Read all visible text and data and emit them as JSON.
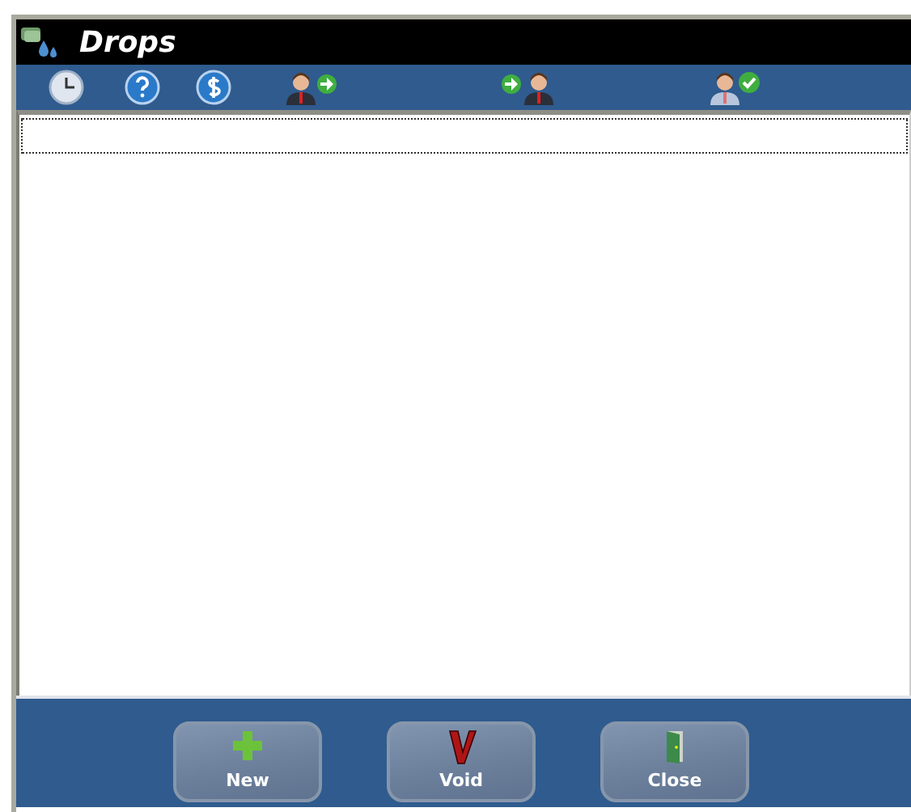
{
  "window": {
    "title": "Drops"
  },
  "columns": [
    {
      "kind": "clock"
    },
    {
      "kind": "help"
    },
    {
      "kind": "money"
    },
    {
      "kind": "person-out"
    },
    {
      "kind": "person-in"
    },
    {
      "kind": "person-approved"
    }
  ],
  "buttons": [
    {
      "label": "New",
      "kind": "new"
    },
    {
      "label": "Void",
      "kind": "void"
    },
    {
      "label": "Close",
      "kind": "close"
    }
  ]
}
